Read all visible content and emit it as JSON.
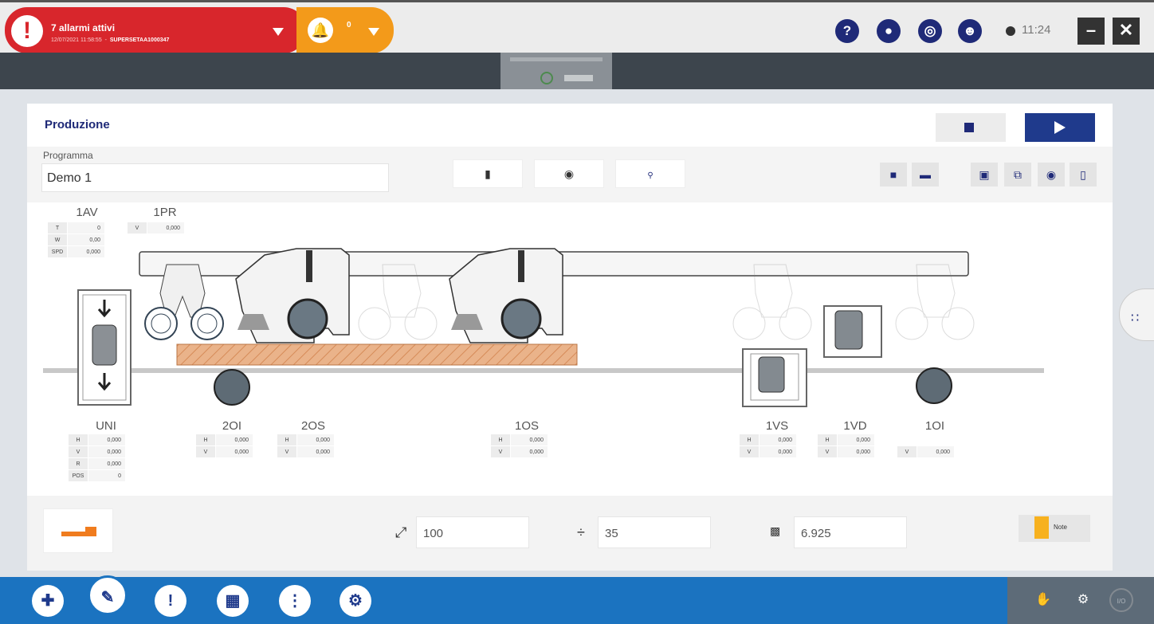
{
  "alarm": {
    "count_label": "7 allarmi attivi",
    "datetime": "12/07/2021 11:58:55",
    "code": "SUPERSETAA1000347"
  },
  "notifications": {
    "count": "0"
  },
  "header": {
    "time": "11:24",
    "icons": [
      "help-icon",
      "users-icon",
      "settings-disc-icon",
      "user-icon"
    ]
  },
  "section": {
    "title": "Produzione"
  },
  "program": {
    "label": "Programma",
    "value": "Demo 1"
  },
  "heads": {
    "AV1": {
      "name": "1AV",
      "rows": [
        [
          "T",
          "0"
        ],
        [
          "W",
          "0,00"
        ],
        [
          "SPD",
          "0,000"
        ]
      ]
    },
    "PR1": {
      "name": "1PR",
      "rows": [
        [
          "V",
          "0,000"
        ]
      ]
    },
    "UNI": {
      "name": "UNI",
      "rows": [
        [
          "H",
          "0,000"
        ],
        [
          "V",
          "0,000"
        ],
        [
          "R",
          "0,000"
        ],
        [
          "POS",
          "0"
        ]
      ]
    },
    "OI2": {
      "name": "2OI",
      "rows": [
        [
          "H",
          "0,000"
        ],
        [
          "V",
          "0,000"
        ]
      ]
    },
    "OS2": {
      "name": "2OS",
      "rows": [
        [
          "H",
          "0,000"
        ],
        [
          "V",
          "0,000"
        ]
      ]
    },
    "OS1": {
      "name": "1OS",
      "rows": [
        [
          "H",
          "0,000"
        ],
        [
          "V",
          "0,000"
        ]
      ]
    },
    "VS1": {
      "name": "1VS",
      "rows": [
        [
          "H",
          "0,000"
        ],
        [
          "V",
          "0,000"
        ]
      ]
    },
    "VD1": {
      "name": "1VD",
      "rows": [
        [
          "H",
          "0,000"
        ],
        [
          "V",
          "0,000"
        ]
      ]
    },
    "OI1": {
      "name": "1OI",
      "rows": [
        [
          "V",
          "0,000"
        ]
      ]
    }
  },
  "bottom": {
    "length": "100",
    "divide": "35",
    "counter": "6.925",
    "note_label": "Note"
  },
  "colors": {
    "alarm": "#d8262c",
    "notification": "#f39a1a",
    "primary": "#1f2a78",
    "nav": "#1b73c0",
    "wood": "#e8a878"
  }
}
